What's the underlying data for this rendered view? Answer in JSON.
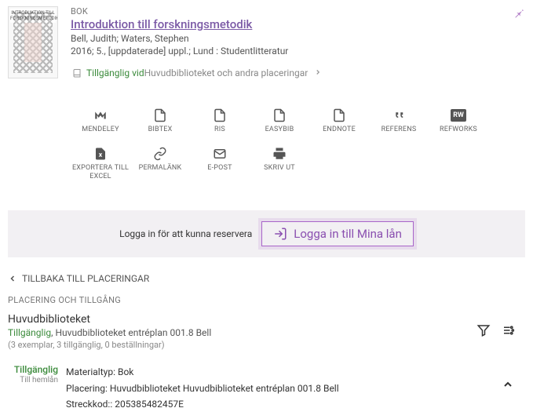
{
  "record": {
    "type": "BOK",
    "title": "Introduktion till forskningsmetodik",
    "authors": "Bell, Judith; Waters, Stephen",
    "publication": "2016; 5., [uppdaterade] uppl.; Lund : Studentlitteratur",
    "availabilityPrefix": "Tillgänglig vid ",
    "availabilityLocation": "Huvudbiblioteket och andra placeringar",
    "thumbLabel": "INTRODUKTION TILL FORSKNINGSMETODIK"
  },
  "actions": [
    {
      "name": "mendeley",
      "label": "MENDELEY",
      "icon": "M"
    },
    {
      "name": "bibtex",
      "label": "BIBTEX",
      "icon": "doc"
    },
    {
      "name": "ris",
      "label": "RIS",
      "icon": "doc"
    },
    {
      "name": "easybib",
      "label": "EASYBIB",
      "icon": "doc"
    },
    {
      "name": "endnote",
      "label": "ENDNOTE",
      "icon": "doc"
    },
    {
      "name": "referens",
      "label": "REFERENS",
      "icon": "quote"
    },
    {
      "name": "refworks",
      "label": "REFWORKS",
      "icon": "rw"
    },
    {
      "name": "exportera-excel",
      "label": "EXPORTERA TILL EXCEL",
      "icon": "excel"
    },
    {
      "name": "permalank",
      "label": "PERMALÄNK",
      "icon": "link"
    },
    {
      "name": "epost",
      "label": "E-POST",
      "icon": "mail"
    },
    {
      "name": "skriv-ut",
      "label": "SKRIV UT",
      "icon": "print"
    }
  ],
  "login": {
    "message": "Logga in för att kunna reservera",
    "button": "Logga in till Mina lån"
  },
  "back": "TILLBAKA TILL PLACERINGAR",
  "section": "PLACERING OCH TILLGÅNG",
  "location": {
    "name": "Huvudbiblioteket",
    "status": "Tillgänglig",
    "where": ", Huvudbiblioteket entréplan 001.8 Bell",
    "copies": "(3 exemplar, 3 tillgänglig, 0 beställningar)"
  },
  "item": {
    "status": "Tillgänglig",
    "sub": "Till hemlån",
    "materialType": {
      "label": "Materialtyp:",
      "value": " Bok"
    },
    "placement": {
      "label": "Placering:",
      "value": " Huvudbiblioteket Huvudbiblioteket entréplan 001.8 Bell"
    },
    "barcode": {
      "label": "Streckkod::",
      "value": " 205385482457E"
    }
  }
}
